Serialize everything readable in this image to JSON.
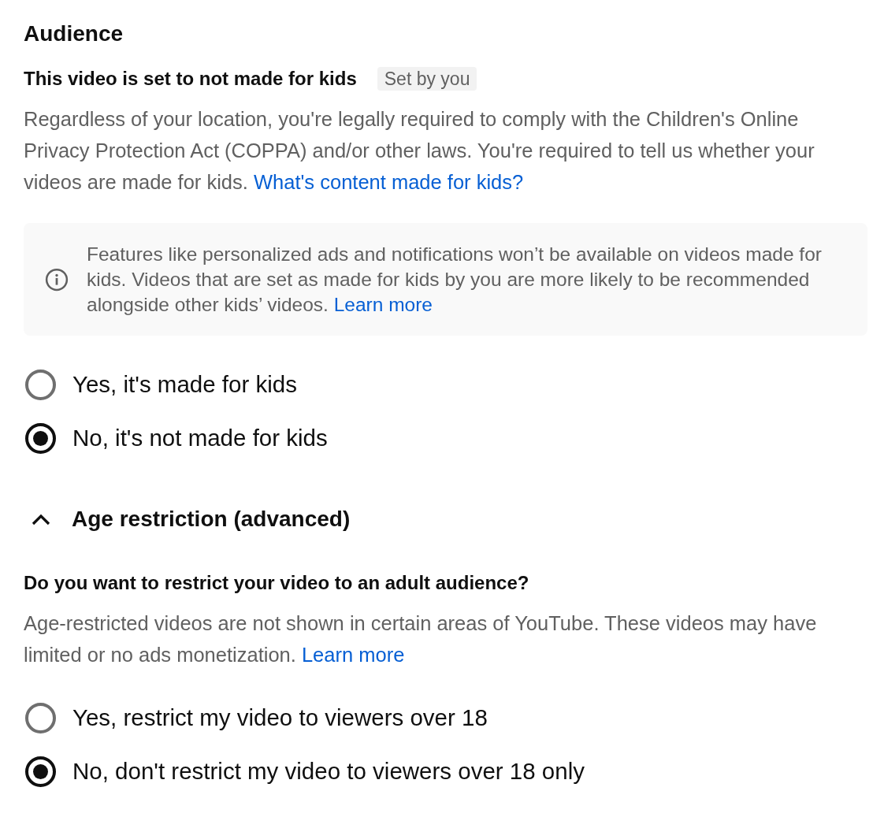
{
  "section": {
    "title": "Audience"
  },
  "kids_status": {
    "heading": "This video is set to not made for kids",
    "badge": "Set by you"
  },
  "kids_description": {
    "text": "Regardless of your location, you're legally required to comply with the Children's Online Privacy Protection Act (COPPA) and/or other laws. You're required to tell us whether your videos are made for kids.",
    "link": "What's content made for kids?"
  },
  "info_notice": {
    "text": "Features like personalized ads and notifications won’t be available on videos made for kids. Videos that are set as made for kids by you are more likely to be recommended alongside other kids’ videos.",
    "link": "Learn more"
  },
  "kids_options": [
    {
      "label": "Yes, it's made for kids",
      "selected": false
    },
    {
      "label": "No, it's not made for kids",
      "selected": true
    }
  ],
  "age_restriction": {
    "title": "Age restriction (advanced)",
    "expanded": true,
    "question": "Do you want to restrict your video to an adult audience?",
    "description": "Age-restricted videos are not shown in certain areas of YouTube. These videos may have limited or no ads monetization.",
    "link": "Learn more",
    "options": [
      {
        "label": "Yes, restrict my video to viewers over 18",
        "selected": false
      },
      {
        "label": "No, don't restrict my video to viewers over 18 only",
        "selected": true
      }
    ]
  }
}
